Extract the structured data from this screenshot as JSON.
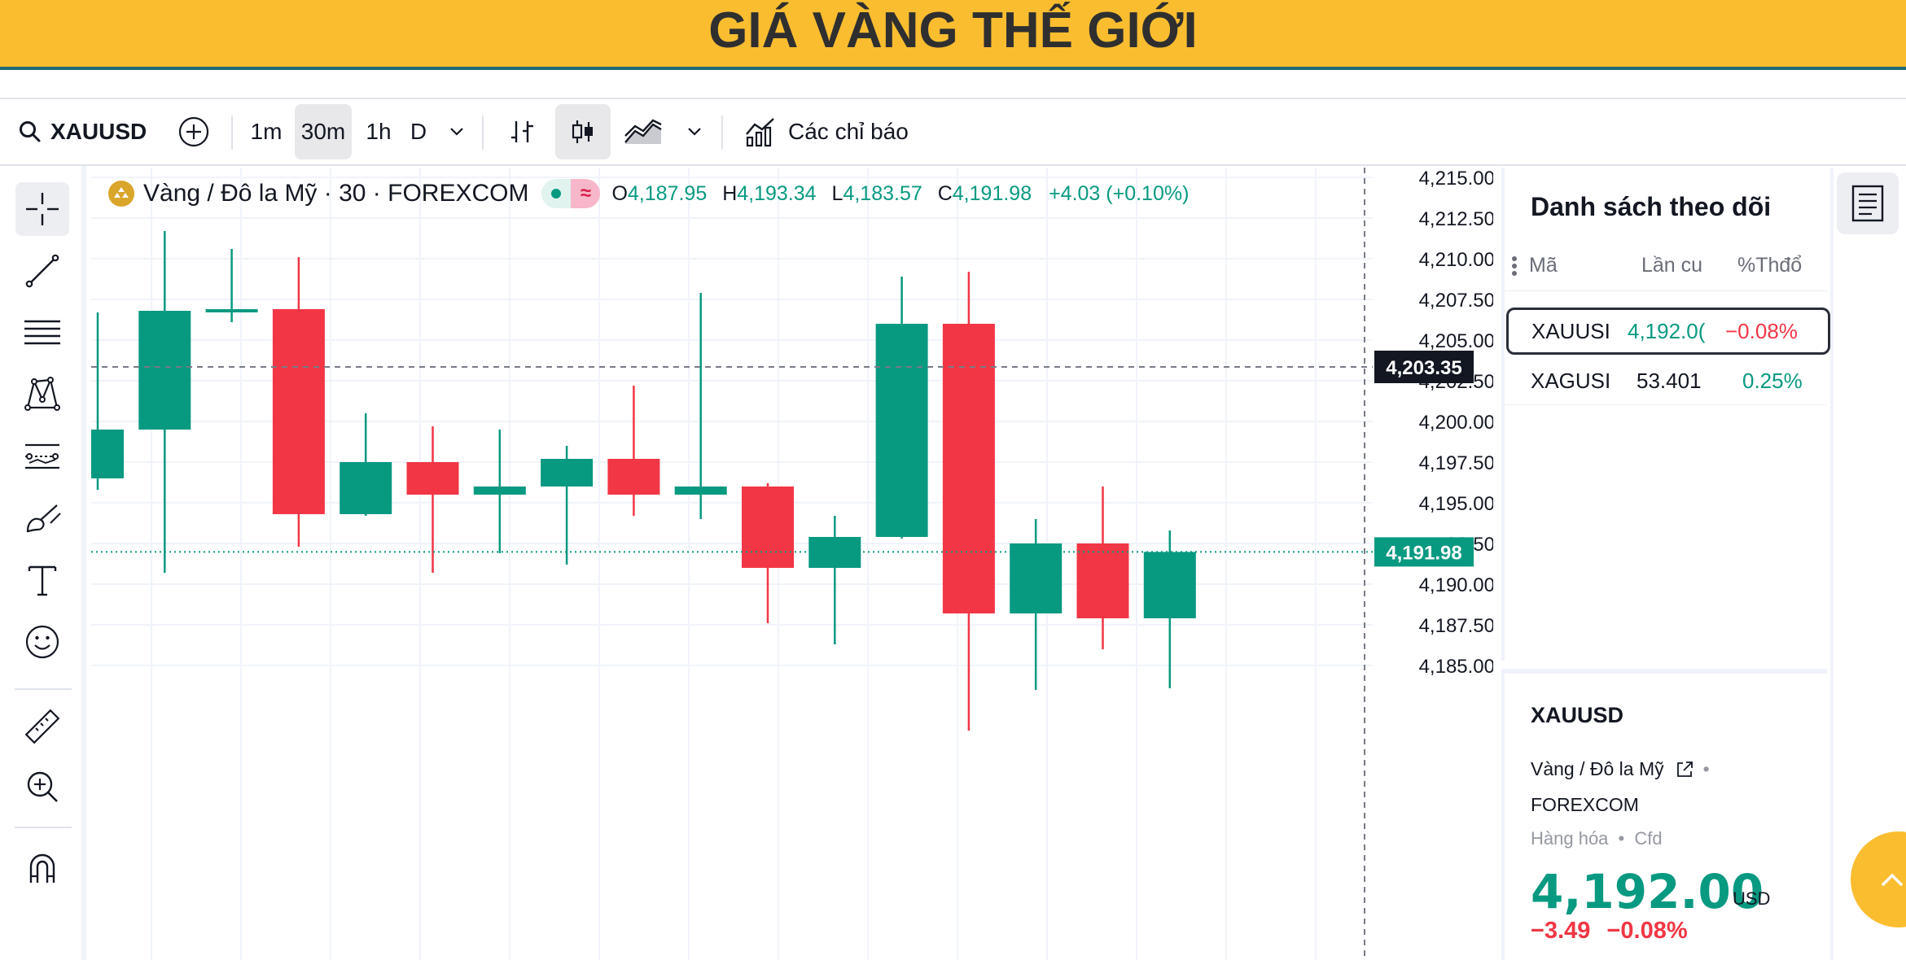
{
  "banner": {
    "title": "GIÁ VÀNG THẾ GIỚI"
  },
  "toolbar": {
    "symbol": "XAUUSD",
    "intervals": [
      "1m",
      "30m",
      "1h",
      "D"
    ],
    "active_interval": "30m",
    "indicators_label": "Các chỉ báo"
  },
  "legend": {
    "name": "Vàng / Đô la Mỹ · 30 · FOREXCOM",
    "o_label": "O",
    "o_value": "4,187.95",
    "h_label": "H",
    "h_value": "4,193.34",
    "l_label": "L",
    "l_value": "4,183.57",
    "c_label": "C",
    "c_value": "4,191.98",
    "change": "+4.03 (+0.10%)"
  },
  "watchlist": {
    "title": "Danh sách theo dõi",
    "columns": [
      "Mã",
      "Lần cu",
      "%Thđổ"
    ],
    "rows": [
      {
        "symbol": "XAUUSI",
        "last": "4,192.0(",
        "chg": "−0.08%",
        "chg_color": "#f23645",
        "last_color": "#089981"
      },
      {
        "symbol": "XAGUSI",
        "last": "53.401",
        "chg": "0.25%",
        "chg_color": "#089981",
        "last_color": "#131722"
      }
    ]
  },
  "details": {
    "symbol": "XAUUSD",
    "name": "Vàng / Đô la Mỹ",
    "exchange": "FOREXCOM",
    "type": "Hàng hóa",
    "subtype": "Cfd",
    "price": "4,192.00",
    "currency": "USD",
    "change": "−3.49",
    "change_pct": "−0.08%"
  },
  "chart_data": {
    "type": "candlestick",
    "title": "Vàng / Đô la Mỹ · 30 · FOREXCOM",
    "ylim": [
      4183.0,
      4216.0
    ],
    "y_ticks": [
      4215.0,
      4212.5,
      4210.0,
      4207.5,
      4205.0,
      4202.5,
      4200.0,
      4197.5,
      4195.0,
      4192.5,
      4190.0,
      4187.5,
      4185.0
    ],
    "y_tick_labels": [
      "4,215.00",
      "4,212.50",
      "4,210.00",
      "4,207.50",
      "4,205.00",
      "4,202.50",
      "4,200.00",
      "4,197.50",
      "4,195.00",
      "4,192.50",
      "4,190.00",
      "4,187.50",
      "4,185.00"
    ],
    "crosshair_price": 4203.35,
    "crosshair_label": "4,203.35",
    "last_price": 4191.98,
    "last_price_label": "4,191.98",
    "colors": {
      "up": "#089981",
      "down": "#f23645"
    },
    "candles": [
      {
        "o": 4196.5,
        "h": 4206.7,
        "l": 4195.8,
        "c": 4199.5
      },
      {
        "o": 4199.5,
        "h": 4211.7,
        "l": 4190.7,
        "c": 4206.8
      },
      {
        "o": 4206.8,
        "h": 4210.6,
        "l": 4206.1,
        "c": 4206.9
      },
      {
        "o": 4206.9,
        "h": 4210.1,
        "l": 4192.3,
        "c": 4194.3
      },
      {
        "o": 4194.3,
        "h": 4200.5,
        "l": 4194.2,
        "c": 4197.5
      },
      {
        "o": 4197.5,
        "h": 4199.7,
        "l": 4190.7,
        "c": 4195.5
      },
      {
        "o": 4195.5,
        "h": 4199.5,
        "l": 4191.9,
        "c": 4196.0
      },
      {
        "o": 4196.0,
        "h": 4198.5,
        "l": 4191.2,
        "c": 4197.7
      },
      {
        "o": 4197.7,
        "h": 4202.2,
        "l": 4194.2,
        "c": 4195.5
      },
      {
        "o": 4195.5,
        "h": 4207.9,
        "l": 4194.0,
        "c": 4196.0
      },
      {
        "o": 4196.0,
        "h": 4196.2,
        "l": 4187.6,
        "c": 4191.0
      },
      {
        "o": 4191.0,
        "h": 4194.2,
        "l": 4186.3,
        "c": 4192.9
      },
      {
        "o": 4192.9,
        "h": 4208.9,
        "l": 4192.8,
        "c": 4206.0
      },
      {
        "o": 4206.0,
        "h": 4209.2,
        "l": 4181.0,
        "c": 4188.2
      },
      {
        "o": 4188.2,
        "h": 4194.0,
        "l": 4183.5,
        "c": 4192.5
      },
      {
        "o": 4192.5,
        "h": 4196.0,
        "l": 4186.0,
        "c": 4187.9
      },
      {
        "o": 4187.9,
        "h": 4193.3,
        "l": 4183.6,
        "c": 4191.98
      }
    ]
  }
}
